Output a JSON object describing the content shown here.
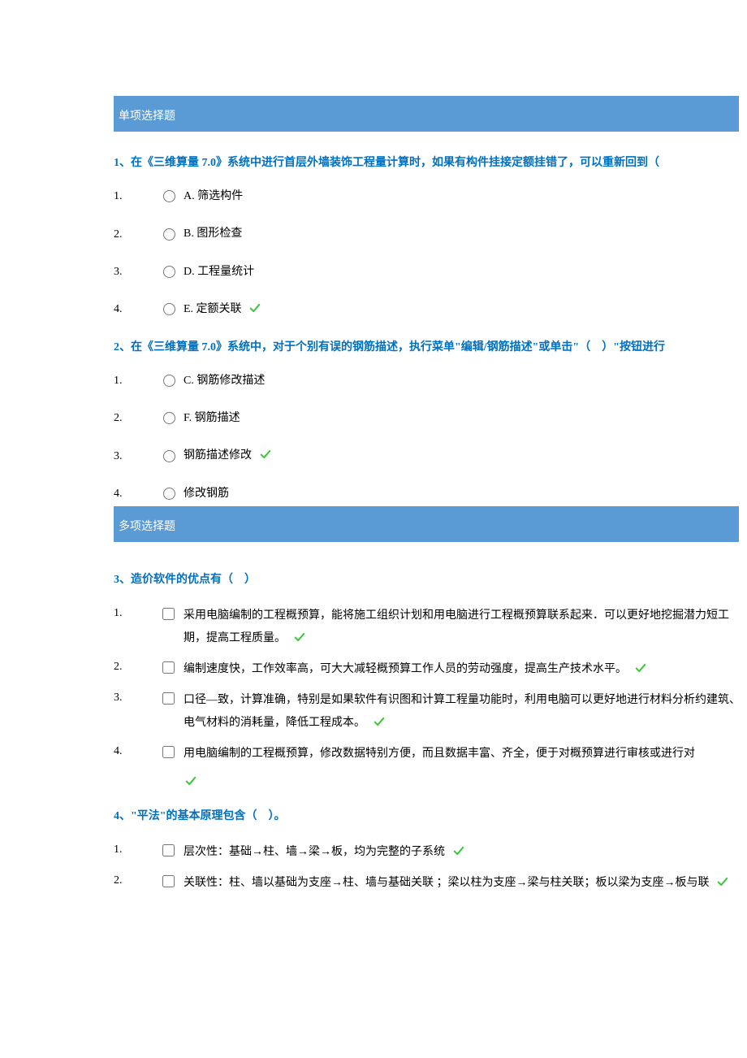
{
  "sections": {
    "single": "单项选择题",
    "multi": "多项选择题"
  },
  "q1": {
    "text": "1、在《三维算量 7.0》系统中进行首层外墙装饰工程量计算时，如果有构件挂接定额挂错了，可以重新回到（",
    "opts": [
      {
        "n": "1.",
        "t": "A. 筛选构件",
        "c": false
      },
      {
        "n": "2.",
        "t": "B. 图形检查",
        "c": false
      },
      {
        "n": "3.",
        "t": "D. 工程量统计",
        "c": false
      },
      {
        "n": "4.",
        "t": "E. 定额关联",
        "c": true
      }
    ]
  },
  "q2": {
    "text": "2、在《三维算量 7.0》系统中，对于个别有误的钢筋描述，执行菜单\"编辑/钢筋描述\"或单击\"（　）\"按钮进行",
    "opts": [
      {
        "n": "1.",
        "t": "C. 钢筋修改描述",
        "c": false
      },
      {
        "n": "2.",
        "t": "F. 钢筋描述",
        "c": false
      },
      {
        "n": "3.",
        "t": "钢筋描述修改",
        "c": true
      },
      {
        "n": "4.",
        "t": "修改钢筋",
        "c": false
      }
    ]
  },
  "q3": {
    "text": "3、造价软件的优点有（　）",
    "opts": [
      {
        "n": "1.",
        "t": "采用电脑编制的工程概预算，能将施工组织计划和用电脑进行工程概预算联系起来．可以更好地挖掘潜力短工期，提高工程质量。",
        "c": true
      },
      {
        "n": "2.",
        "t": "编制速度快，工作效率高，可大大减轻概预算工作人员的劳动强度，提高生产技术水平。",
        "c": true
      },
      {
        "n": "3.",
        "t": "口径—致，计算准确，特别是如果软件有识图和计算工程量功能时，利用电脑可以更好地进行材料分析约建筑、电气材料的消耗量，降低工程成本。",
        "c": true
      },
      {
        "n": "4.",
        "t": "用电脑编制的工程概预算，修改数据特别方便，而且数据丰富、齐全，便于对概预算进行审核或进行对",
        "c": true,
        "checkBelow": true
      }
    ]
  },
  "q4": {
    "text": "4、\"平法\"的基本原理包含（　）。",
    "opts": [
      {
        "n": "1.",
        "t": "层次性：基础→柱、墙→梁→板，均为完整的子系统",
        "c": true
      },
      {
        "n": "2.",
        "t": "关联性：柱、墙以基础为支座→柱、墙与基础关联 ；梁以柱为支座→梁与柱关联；板以梁为支座→板与联",
        "c": true
      }
    ]
  }
}
